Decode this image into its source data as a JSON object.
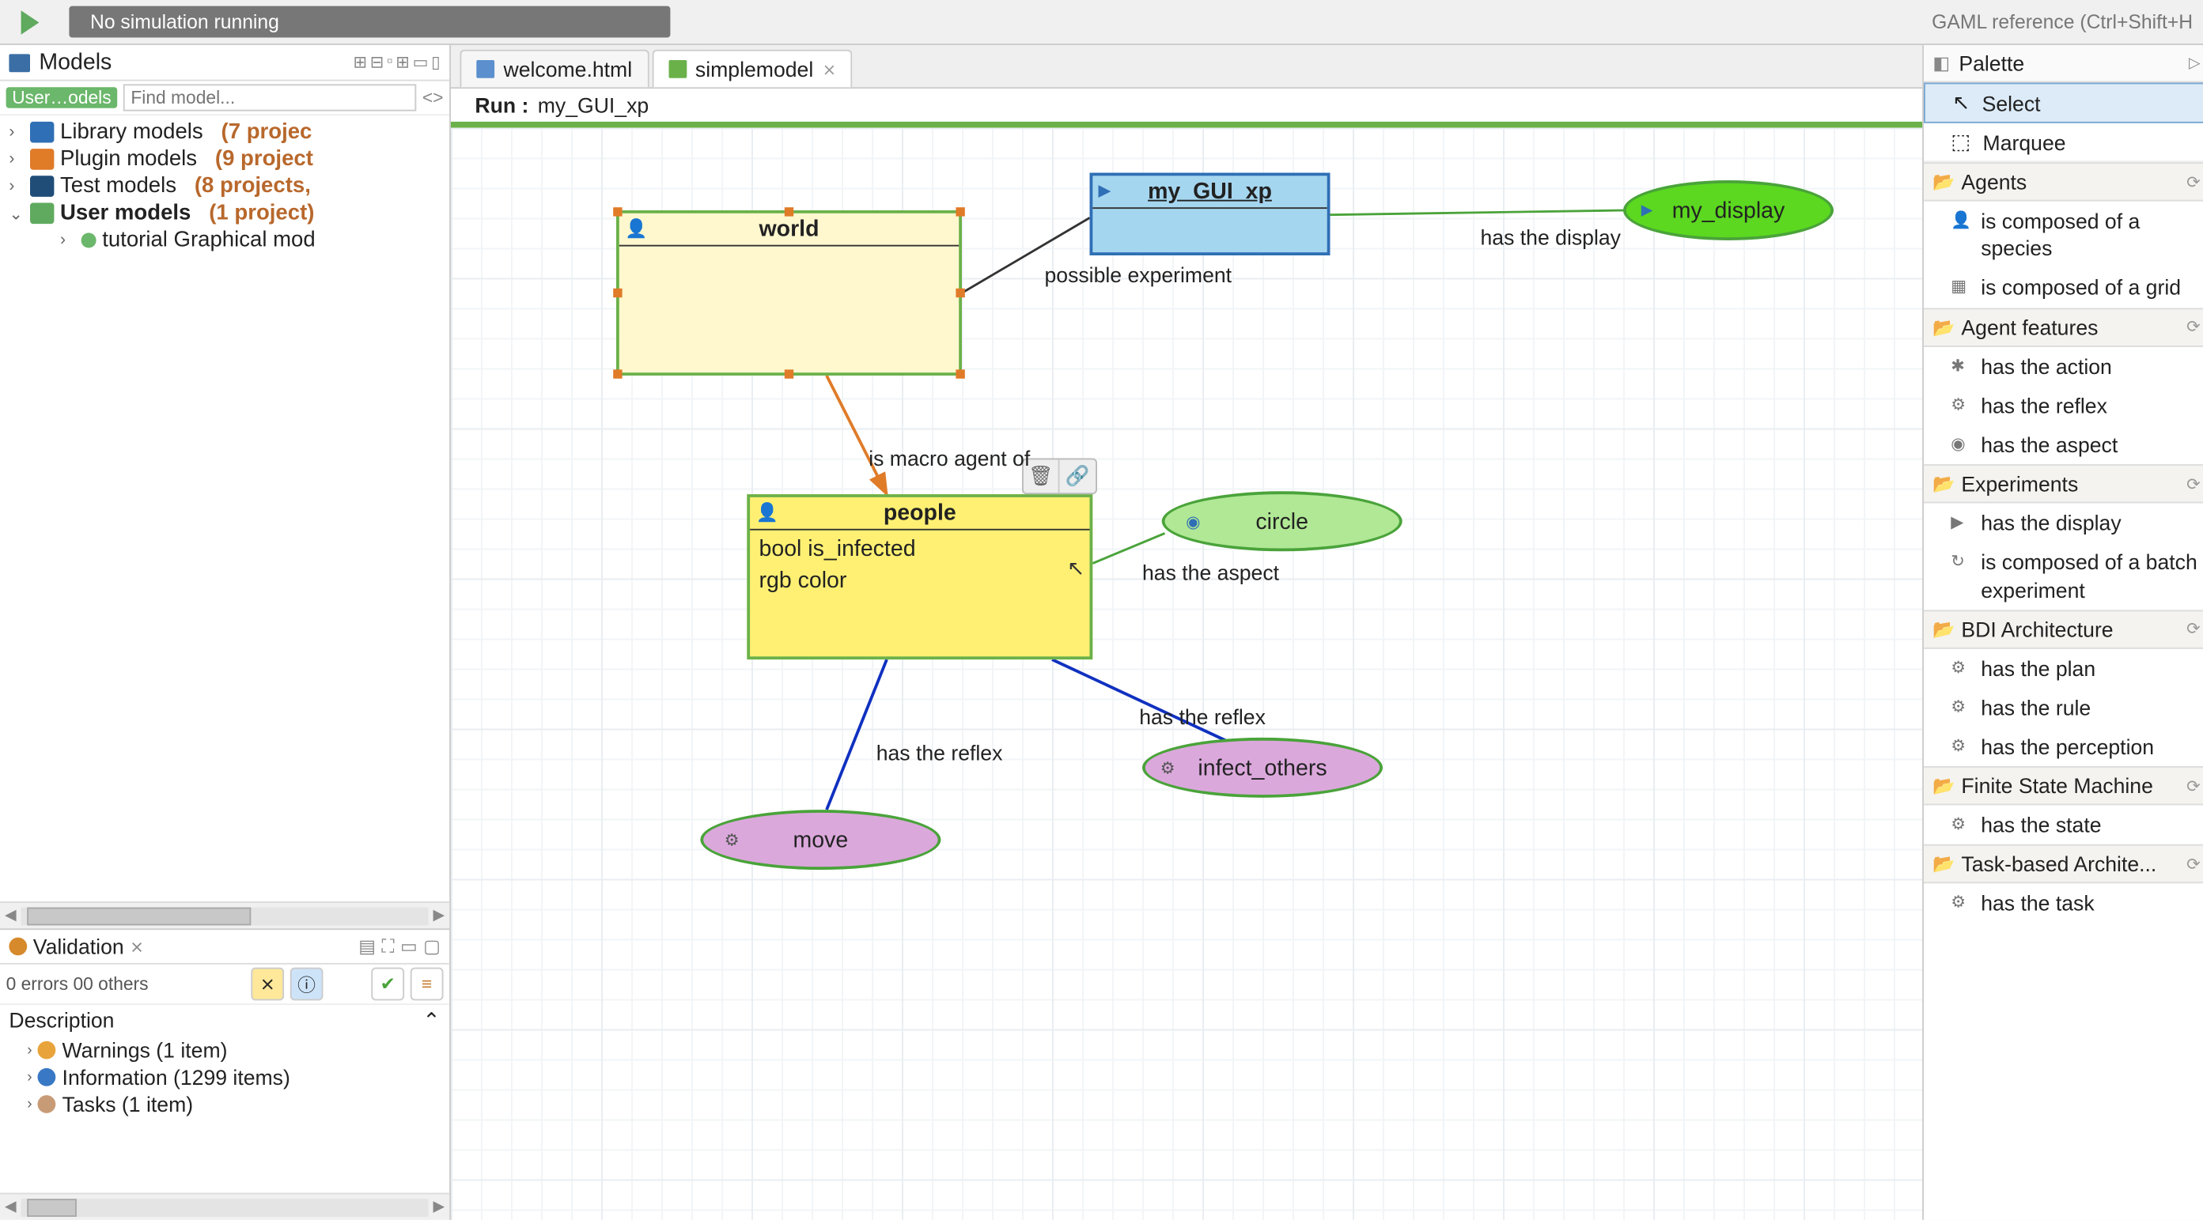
{
  "topbar": {
    "sim_status": "No simulation running",
    "gaml_ref": "GAML reference (Ctrl+Shift+H"
  },
  "models_panel": {
    "title": "Models",
    "find_placeholder": "Find model...",
    "user_btn": "User…odels",
    "tree": [
      {
        "label": "Library models",
        "count": "(7 projec"
      },
      {
        "label": "Plugin models",
        "count": "(9 project"
      },
      {
        "label": "Test models",
        "count": "(8 projects,"
      },
      {
        "label": "User models",
        "count": "(1 project)",
        "expanded": true,
        "children": [
          {
            "label": "tutorial Graphical mod"
          }
        ]
      }
    ]
  },
  "validation": {
    "tab_label": "Validation",
    "status": "0 errors   00 others",
    "desc_header": "Description",
    "items": [
      {
        "label": "Warnings (1 item)"
      },
      {
        "label": "Information (1299 items)"
      },
      {
        "label": "Tasks (1 item)"
      }
    ]
  },
  "editor": {
    "tabs": [
      {
        "label": "welcome.html"
      },
      {
        "label": "simplemodel",
        "active": true
      }
    ],
    "run_label": "Run :",
    "run_target": "my_GUI_xp"
  },
  "diagram": {
    "nodes": {
      "world": {
        "title": "world"
      },
      "experiment": {
        "title": "my_GUI_xp"
      },
      "people": {
        "title": "people",
        "attrs": [
          "bool is_infected",
          "rgb color"
        ]
      },
      "display": {
        "label": "my_display"
      },
      "circle": {
        "label": "circle"
      },
      "move": {
        "label": "move"
      },
      "infect": {
        "label": "infect_others"
      }
    },
    "edge_labels": {
      "possible_experiment": "possible experiment",
      "has_display": "has the display",
      "is_macro": "is macro agent of",
      "has_aspect": "has the aspect",
      "has_reflex1": "has the reflex",
      "has_reflex2": "has the reflex"
    }
  },
  "palette": {
    "title": "Palette",
    "tools": [
      {
        "label": "Select",
        "selected": true
      },
      {
        "label": "Marquee"
      }
    ],
    "categories": [
      {
        "name": "Agents",
        "items": [
          {
            "label": "is composed of a species",
            "icon": "person"
          },
          {
            "label": "is composed of a grid",
            "icon": "grid"
          }
        ]
      },
      {
        "name": "Agent features",
        "items": [
          {
            "label": "has the action",
            "icon": "gear"
          },
          {
            "label": "has the reflex",
            "icon": "gear"
          },
          {
            "label": "has the aspect",
            "icon": "eye"
          }
        ]
      },
      {
        "name": "Experiments",
        "items": [
          {
            "label": "has the display",
            "icon": "tri"
          },
          {
            "label": "is composed of a batch experiment",
            "icon": "cycle"
          }
        ]
      },
      {
        "name": "BDI Architecture",
        "items": [
          {
            "label": "has the plan",
            "icon": "gear"
          },
          {
            "label": "has the rule",
            "icon": "gear"
          },
          {
            "label": "has the perception",
            "icon": "gear"
          }
        ]
      },
      {
        "name": "Finite State Machine",
        "items": [
          {
            "label": "has the state",
            "icon": "gear"
          }
        ]
      },
      {
        "name": "Task-based Archite...",
        "items": [
          {
            "label": "has the task",
            "icon": "gear"
          }
        ]
      }
    ]
  }
}
